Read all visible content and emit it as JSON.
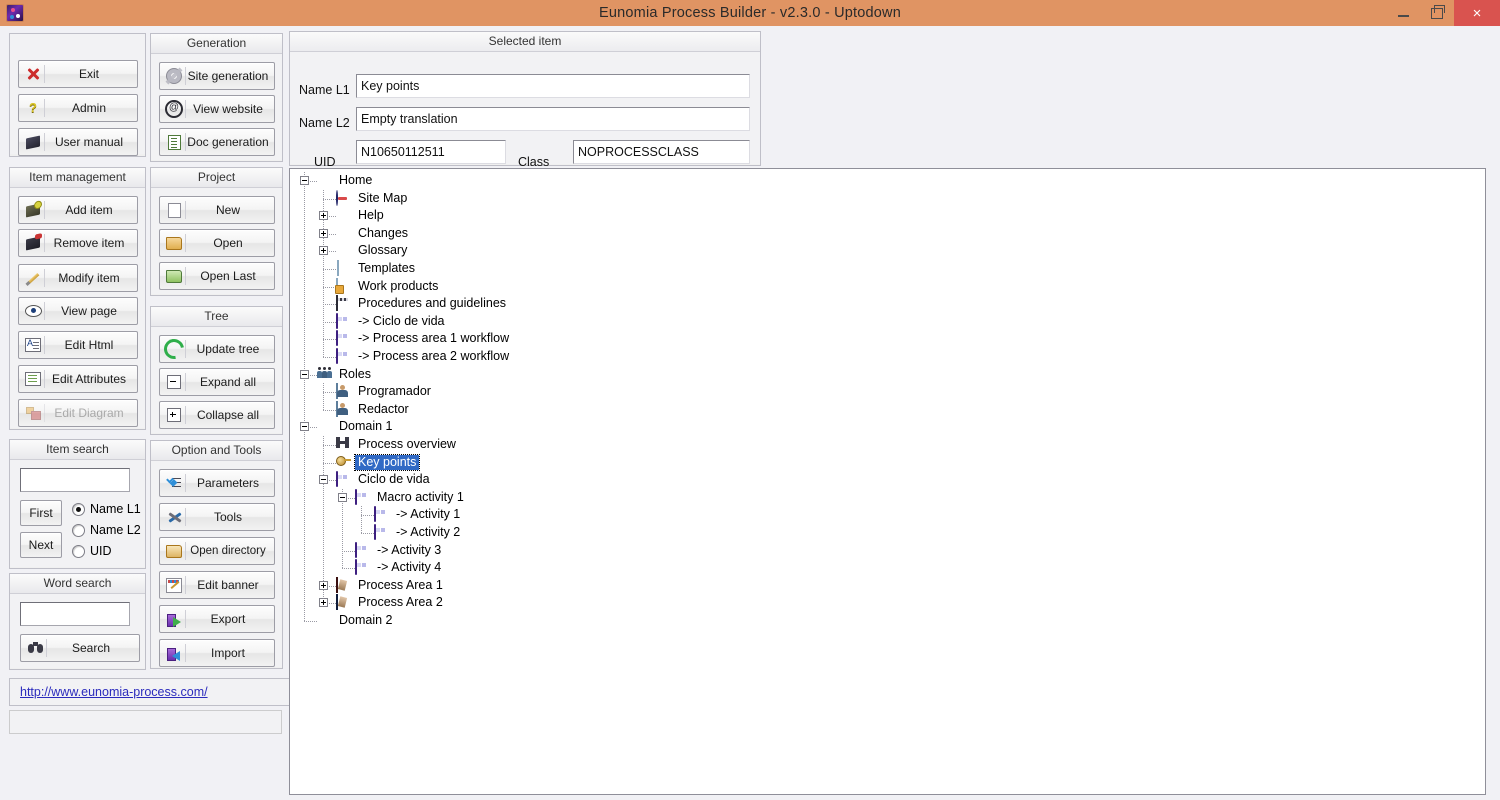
{
  "window": {
    "title": "Eunomia Process Builder - v2.3.0  - Uptodown",
    "app_icon": "app-icon",
    "minimize_label": "",
    "maximize_label": "",
    "close_label": "×",
    "titlebar_color": "#e09463",
    "close_color": "#d9534f"
  },
  "main_actions": {
    "buttons": [
      {
        "label": "Exit",
        "icon": "red-cross-icon",
        "enabled": true
      },
      {
        "label": "Admin",
        "icon": "question-key-icon",
        "enabled": true
      },
      {
        "label": "User manual",
        "icon": "book-icon",
        "enabled": true
      }
    ]
  },
  "item_management": {
    "title": "Item management",
    "buttons": [
      {
        "label": "Add item",
        "icon": "add-book-icon",
        "enabled": true
      },
      {
        "label": "Remove item",
        "icon": "remove-book-icon",
        "enabled": true
      },
      {
        "label": "Modify item",
        "icon": "pencil-icon",
        "enabled": true
      },
      {
        "label": "View page",
        "icon": "eye-icon",
        "enabled": true
      },
      {
        "label": "Edit Html",
        "icon": "html-document-icon",
        "enabled": true
      },
      {
        "label": "Edit Attributes",
        "icon": "attributes-list-icon",
        "enabled": true
      },
      {
        "label": "Edit Diagram",
        "icon": "diagram-icon",
        "enabled": false
      }
    ]
  },
  "item_search": {
    "title": "Item search",
    "input_value": "",
    "first_label": "First",
    "next_label": "Next",
    "radios": [
      {
        "label": "Name L1",
        "selected": true
      },
      {
        "label": "Name L2",
        "selected": false
      },
      {
        "label": "UID",
        "selected": false
      }
    ]
  },
  "word_search": {
    "title": "Word search",
    "input_value": "",
    "search_label": "Search",
    "search_icon": "binoculars-icon"
  },
  "link": {
    "text": "http://www.eunomia-process.com/",
    "color": "#2b2bbd"
  },
  "generation": {
    "title": "Generation",
    "buttons": [
      {
        "label": "Site generation",
        "icon": "gear-icon",
        "enabled": true
      },
      {
        "label": "View website",
        "icon": "at-sign-icon",
        "enabled": true
      },
      {
        "label": "Doc generation",
        "icon": "document-icon",
        "enabled": true
      }
    ]
  },
  "project": {
    "title": "Project",
    "buttons": [
      {
        "label": "New",
        "icon": "new-file-icon",
        "enabled": true
      },
      {
        "label": "Open",
        "icon": "open-folder-icon",
        "enabled": true
      },
      {
        "label": "Open Last",
        "icon": "open-folder-green-icon",
        "enabled": true
      }
    ]
  },
  "tree_actions": {
    "title": "Tree",
    "buttons": [
      {
        "label": "Update tree",
        "icon": "refresh-icon",
        "enabled": true
      },
      {
        "label": "Expand all",
        "icon": "expand-box-icon",
        "enabled": true
      },
      {
        "label": "Collapse all",
        "icon": "collapse-box-icon",
        "enabled": true
      }
    ]
  },
  "option_and_tools": {
    "title": "Option and Tools",
    "buttons": [
      {
        "label": "Parameters",
        "icon": "checklist-icon",
        "enabled": true
      },
      {
        "label": "Tools",
        "icon": "tools-icon",
        "enabled": true
      },
      {
        "label": "Open directory",
        "icon": "folder-icon",
        "enabled": true
      },
      {
        "label": "Edit banner",
        "icon": "banner-edit-icon",
        "enabled": true
      },
      {
        "label": "Export",
        "icon": "export-icon",
        "enabled": true
      },
      {
        "label": "Import",
        "icon": "import-icon",
        "enabled": true
      }
    ]
  },
  "selected_item": {
    "title": "Selected item",
    "name_l1_label": "Name L1",
    "name_l1_value": "Key points",
    "name_l2_label": "Name L2",
    "name_l2_value": "Empty translation",
    "uid_label": "UID",
    "uid_value": "N10650112511",
    "class_label": "Class",
    "class_value": "NOPROCESSCLASS"
  },
  "tree": {
    "selected_node": "Key points",
    "selection_color": "#316ac5",
    "nodes": [
      {
        "label": "Home",
        "depth": 0,
        "icon": "book-icon",
        "toggle": "minus"
      },
      {
        "label": "Site Map",
        "depth": 1,
        "icon": "sitemap-icon",
        "toggle": "none"
      },
      {
        "label": "Help",
        "depth": 1,
        "icon": "book-icon",
        "toggle": "plus"
      },
      {
        "label": "Changes",
        "depth": 1,
        "icon": "book-icon",
        "toggle": "plus"
      },
      {
        "label": "Glossary",
        "depth": 1,
        "icon": "book-icon",
        "toggle": "plus"
      },
      {
        "label": "Templates",
        "depth": 1,
        "icon": "page-icon",
        "toggle": "none"
      },
      {
        "label": "Work products",
        "depth": 1,
        "icon": "work-product-icon",
        "toggle": "none"
      },
      {
        "label": "Procedures and guidelines",
        "depth": 1,
        "icon": "procedures-icon",
        "toggle": "none"
      },
      {
        "label": "-> Ciclo de vida",
        "depth": 1,
        "icon": "workflow-icon",
        "toggle": "none"
      },
      {
        "label": "-> Process area 1 workflow",
        "depth": 1,
        "icon": "workflow-icon",
        "toggle": "none"
      },
      {
        "label": "-> Process area 2 workflow",
        "depth": 1,
        "icon": "workflow-icon",
        "toggle": "none"
      },
      {
        "label": "Roles",
        "depth": 0,
        "icon": "roles-icon",
        "toggle": "minus"
      },
      {
        "label": "Programador",
        "depth": 1,
        "icon": "person-icon",
        "toggle": "none"
      },
      {
        "label": "Redactor",
        "depth": 1,
        "icon": "person-icon",
        "toggle": "none"
      },
      {
        "label": "Domain 1",
        "depth": 0,
        "icon": "domain-ring-icon",
        "toggle": "minus"
      },
      {
        "label": "Process overview",
        "depth": 1,
        "icon": "overview-icon",
        "toggle": "none"
      },
      {
        "label": "Key points",
        "depth": 1,
        "icon": "key-icon",
        "toggle": "none"
      },
      {
        "label": "Ciclo de vida",
        "depth": 1,
        "icon": "workflow-icon",
        "toggle": "minus"
      },
      {
        "label": "Macro activity 1",
        "depth": 2,
        "icon": "workflow-icon",
        "toggle": "minus"
      },
      {
        "label": "-> Activity 1",
        "depth": 3,
        "icon": "workflow-icon",
        "toggle": "none"
      },
      {
        "label": "-> Activity 2",
        "depth": 3,
        "icon": "workflow-icon",
        "toggle": "none"
      },
      {
        "label": "-> Activity 3",
        "depth": 2,
        "icon": "workflow-icon",
        "toggle": "none"
      },
      {
        "label": "-> Activity 4",
        "depth": 2,
        "icon": "workflow-icon",
        "toggle": "none"
      },
      {
        "label": "Process Area 1",
        "depth": 1,
        "icon": "process-area-icon",
        "toggle": "plus"
      },
      {
        "label": "Process Area 2",
        "depth": 1,
        "icon": "process-area-b-icon",
        "toggle": "plus"
      },
      {
        "label": "Domain 2",
        "depth": 0,
        "icon": "domain-ring-icon",
        "toggle": "none"
      }
    ]
  }
}
